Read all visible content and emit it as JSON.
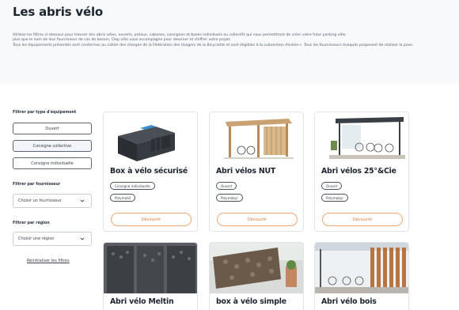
{
  "header": {
    "title": "Les abris vélo",
    "intro": [
      "Utilisez les filtres ci-dessous pour trouver des abris vélos, ouverts, préaux, cabanes, consignes et boxes individuels ou collectifs qui vous permettront de créer votre futur parking vélo.",
      "plus que le nom de leur fournisseur de cas de besoin, Clep vélo vous accompagne pour dessiner et chiffrer votre projet.",
      "Tous les équipements présentés sont conformes au cahier des charges de la Fédération des Usagers de la Bicyclette et sont éligibles à la subvention Alvéole+. Tous les fournisseurs évoqués proposent de réaliser la pose."
    ]
  },
  "filters": {
    "type_title": "Filtrer par type d'équipement",
    "type_options": [
      "Ouvert",
      "Consigne collective",
      "Consigne individuelle"
    ],
    "supplier_title": "Filtrer par fournisseur",
    "supplier_placeholder": "Choisir un fournisseur",
    "region_title": "Filtrer par région",
    "region_placeholder": "Choisir une région",
    "reset_label": "Réinitialiser les filtres"
  },
  "cards": [
    {
      "title": "Box à vélo sécurisé",
      "tags": [
        "Consigne individuelle",
        "Polymobil"
      ],
      "button": "Découvrir"
    },
    {
      "title": "Abri vélos NUT",
      "tags": [
        "Ouvert",
        "Polymobyl"
      ],
      "button": "Découvrir"
    },
    {
      "title": "Abri vélos 25°&Cie",
      "tags": [
        "Ouvert",
        "Polymobyl"
      ],
      "button": "Découvrir"
    },
    {
      "title": "Abri vélo Meltin",
      "tags": [],
      "button": ""
    },
    {
      "title": "box à vélo simple",
      "tags": [],
      "button": ""
    },
    {
      "title": "Abri vélo bois",
      "tags": [],
      "button": ""
    }
  ],
  "colors": {
    "accent": "#e07a3a",
    "accent_border": "#f0a878",
    "text": "#1c2430"
  }
}
